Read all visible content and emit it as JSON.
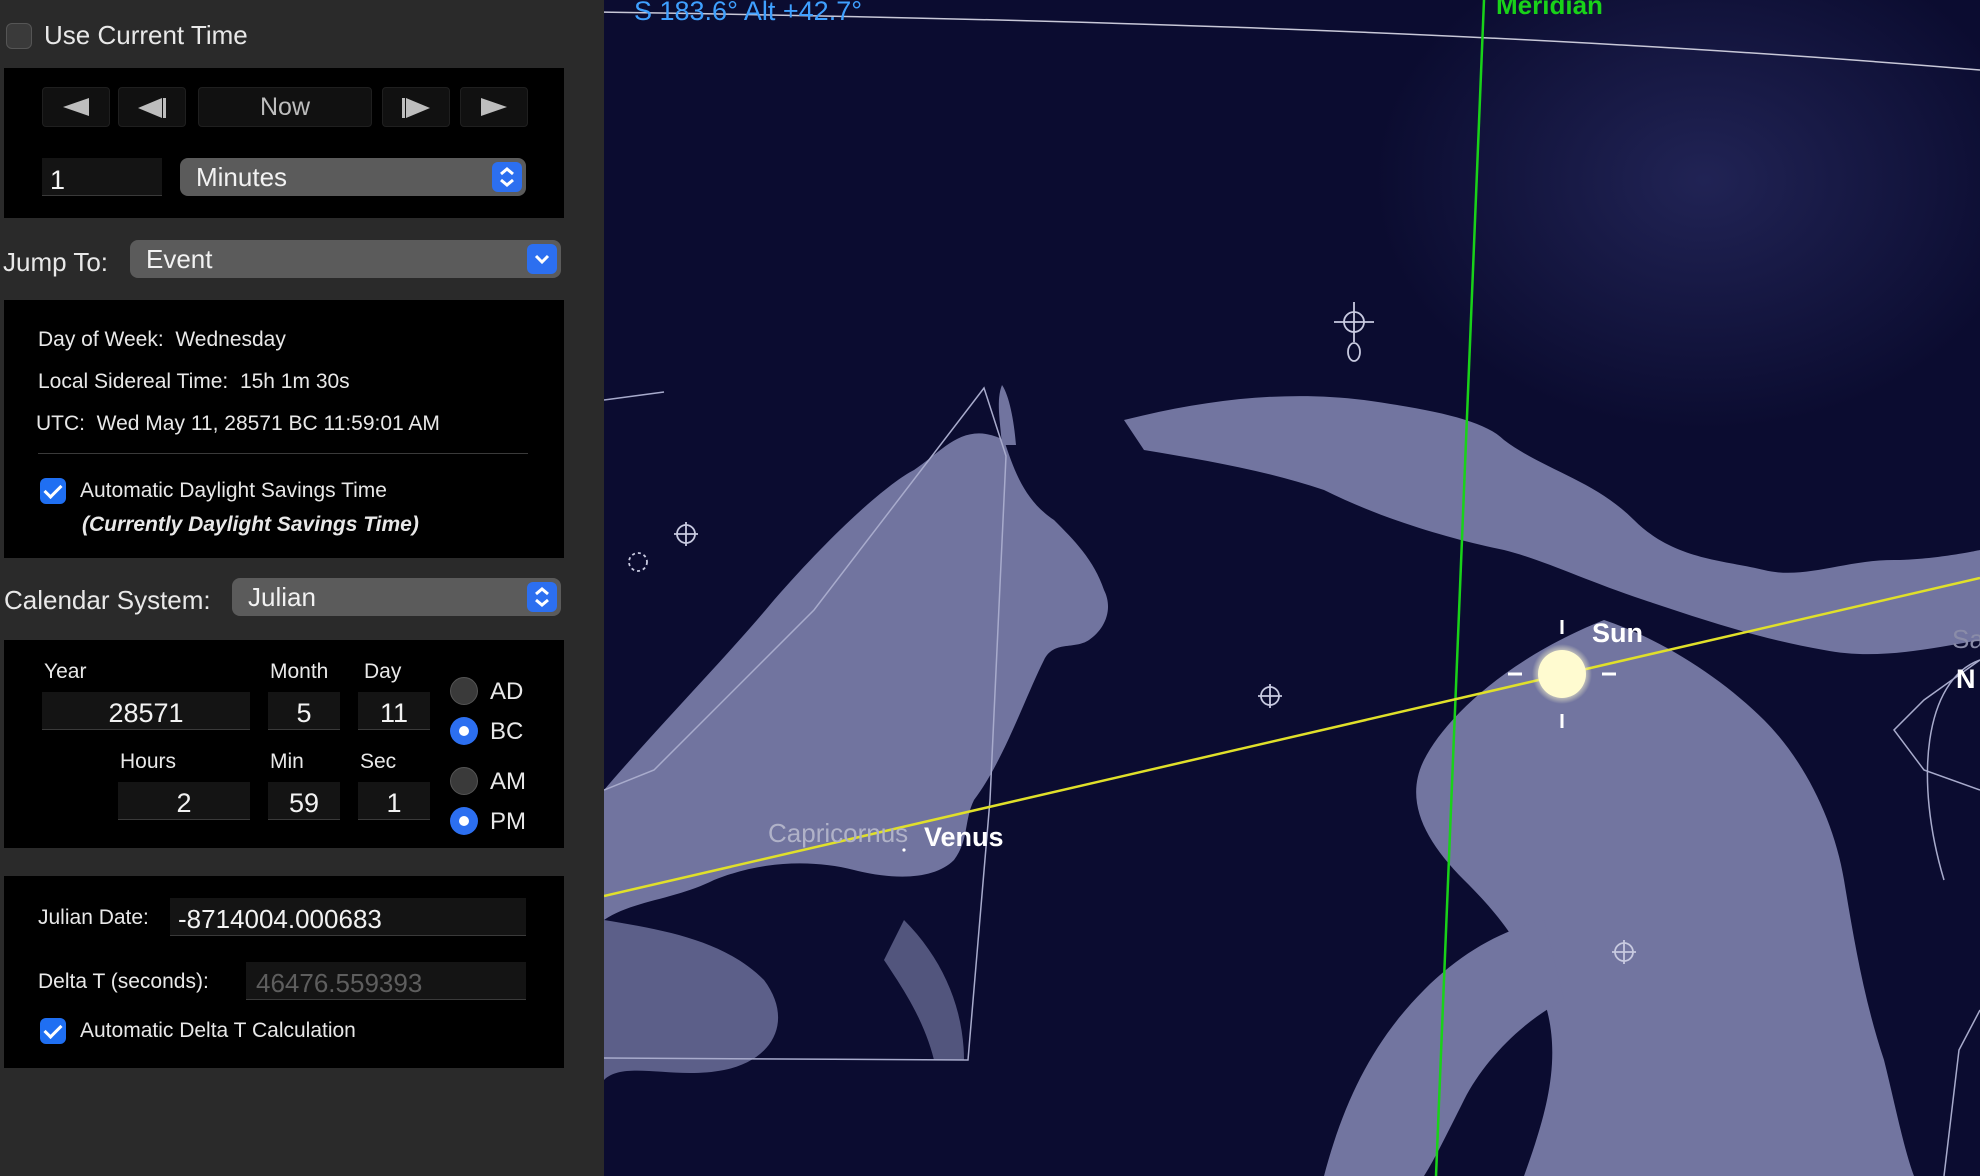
{
  "panel": {
    "use_current_time": {
      "label": "Use Current Time",
      "checked": false
    },
    "step_controls": {
      "buttons": [
        {
          "name": "step-back-fast-button",
          "icon": "triangle-left-icon",
          "label": ""
        },
        {
          "name": "step-back-button",
          "icon": "step-left-icon",
          "label": ""
        },
        {
          "name": "now-button",
          "icon": "",
          "label": "Now"
        },
        {
          "name": "step-forward-button",
          "icon": "step-right-icon",
          "label": ""
        },
        {
          "name": "step-forward-fast-button",
          "icon": "triangle-right-icon",
          "label": ""
        }
      ],
      "step_amount": "1",
      "step_unit": "Minutes"
    },
    "jump_to": {
      "label": "Jump To:",
      "value": "Event"
    },
    "info": {
      "day_of_week_label": "Day of Week:",
      "day_of_week": "Wednesday",
      "sidereal_label": "Local Sidereal Time:",
      "sidereal": "15h 1m 30s",
      "utc_label": "UTC:",
      "utc": "Wed May 11, 28571 BC 11:59:01 AM",
      "auto_dst_label": "Automatic Daylight Savings Time",
      "auto_dst_checked": true,
      "dst_status": "(Currently Daylight Savings Time)"
    },
    "calendar": {
      "label": "Calendar System:",
      "value": "Julian"
    },
    "date": {
      "year_label": "Year",
      "year": "28571",
      "month_label": "Month",
      "month": "5",
      "day_label": "Day",
      "day": "11",
      "hours_label": "Hours",
      "hours": "2",
      "min_label": "Min",
      "min": "59",
      "sec_label": "Sec",
      "sec": "1",
      "ad_label": "AD",
      "bc_label": "BC",
      "era": "BC",
      "am_label": "AM",
      "pm_label": "PM",
      "meridiem": "PM"
    },
    "julian": {
      "julian_date_label": "Julian Date:",
      "julian_date": "-8714004.000683",
      "delta_t_label": "Delta T (seconds):",
      "delta_t": "46476.559393",
      "auto_delta_label": "Automatic Delta T Calculation",
      "auto_delta_checked": true
    }
  },
  "sky": {
    "coordinates": "S 183.6° Alt +42.7°",
    "meridian_label": "Meridian",
    "sun_label": "Sun",
    "venus_label": "Venus",
    "constellation_label": "Capricornus",
    "edge_label_1": "Sa",
    "edge_label_2": "N",
    "colors": {
      "background": "#0b0c30",
      "meridian": "#19d219",
      "ecliptic": "#e0e02a",
      "coordinates": "#3fa0ff",
      "figure": "#b4b8dc",
      "sun": "#fffbd0"
    }
  }
}
